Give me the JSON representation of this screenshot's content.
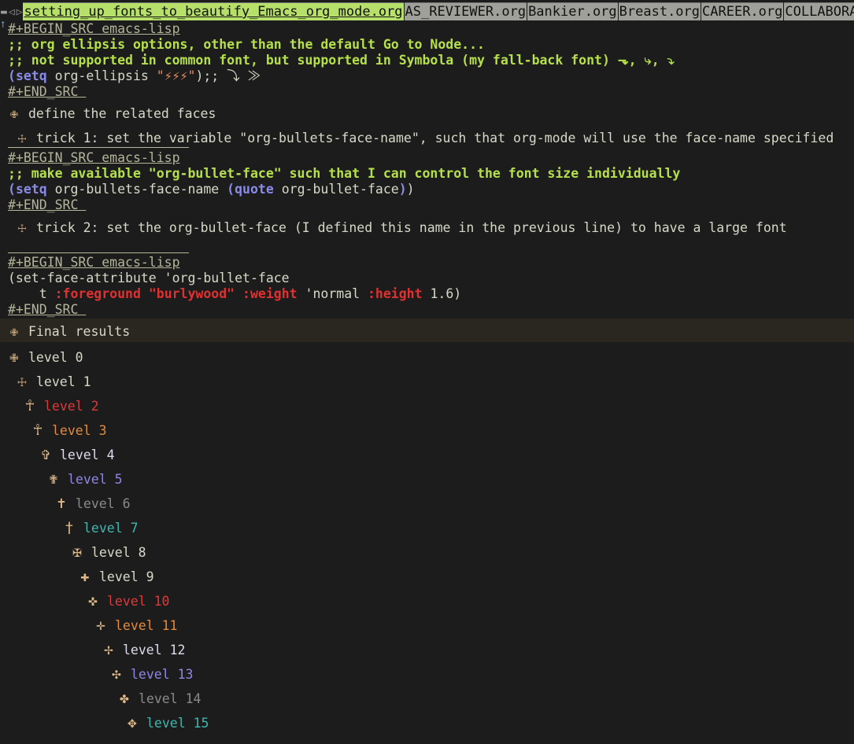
{
  "tabs": [
    {
      "label": "setting_up_fonts_to_beautify_Emacs_org_mode.org",
      "active": true
    },
    {
      "label": "AS_REVIEWER.org",
      "active": false
    },
    {
      "label": "Bankier.org",
      "active": false
    },
    {
      "label": "Breast.org",
      "active": false
    },
    {
      "label": "CAREER.org",
      "active": false
    },
    {
      "label": "COLLABORATI",
      "active": false
    }
  ],
  "tab_controls": {
    "collapse": "▬",
    "left": "◁",
    "right": "▷"
  },
  "scroll_up_indicator": "⭡",
  "block1": {
    "begin": "#+BEGIN_SRC emacs-lisp",
    "comment1": ";; org ellipsis options, other than the default Go to Node...",
    "comment2": ";; not supported in common font, but supported in Symbola (my fall-back font) ⬎, ⤷, ⤵",
    "code_open": "(",
    "code_setq": "setq",
    "code_var": " org-ellipsis ",
    "code_str": "\"⚡⚡⚡\"",
    "code_close": ");; ⤵ ≫",
    "end": "#+END_SRC "
  },
  "heading_define": {
    "bullet": "✙",
    "text": "define the related faces"
  },
  "trick1": {
    "bullet": "☩",
    "text": "trick 1: set the variable \"org-bullets-face-name\", such that org-mode will use the face-name specified"
  },
  "block2": {
    "begin": "#+BEGIN_SRC emacs-lisp",
    "comment": ";; make available \"org-bullet-face\" such that I can control the font size individually",
    "open": "(",
    "setq": "setq",
    "var": " org-bullets-face-name ",
    "qopen": "(",
    "quote": "quote",
    "qarg": " org-bullet-face",
    "qclose": ")",
    "close": ")",
    "end": "#+END_SRC "
  },
  "trick2": {
    "bullet": "☩",
    "text": "trick 2: set the org-bullet-face (I defined this name in the previous line) to have a large font"
  },
  "block3": {
    "begin": "#+BEGIN_SRC emacs-lisp",
    "line1": "(set-face-attribute 'org-bullet-face",
    "line2_indent": "    t ",
    "kw_foreground": ":foreground",
    "val_color": "\"burlywood\"",
    "kw_weight": ":weight",
    "val_weight": " 'normal ",
    "kw_height": ":height",
    "val_height": " 1.6)",
    "end": "#+END_SRC "
  },
  "final_heading": {
    "bullet": "✙",
    "text": "Final results"
  },
  "levels": [
    {
      "bullet": "✙",
      "text": "level 0",
      "color": "#d8d8c8"
    },
    {
      "bullet": "☩",
      "text": "level 1",
      "color": "#d8d8c8"
    },
    {
      "bullet": "☥",
      "text": "level 2",
      "color": "#e03838"
    },
    {
      "bullet": "☥",
      "text": "level 3",
      "color": "#e58a3a"
    },
    {
      "bullet": "✞",
      "text": "level 4",
      "color": "#dcdcec"
    },
    {
      "bullet": "✟",
      "text": "level 5",
      "color": "#8e86e8"
    },
    {
      "bullet": "✝",
      "text": "level 6",
      "color": "#8a8a8a"
    },
    {
      "bullet": "†",
      "text": "level 7",
      "color": "#3cb8b0"
    },
    {
      "bullet": "✠",
      "text": "level 8",
      "color": "#d8d8c8"
    },
    {
      "bullet": "✚",
      "text": "level 9",
      "color": "#d8d8c8"
    },
    {
      "bullet": "✜",
      "text": "level 10",
      "color": "#e03838"
    },
    {
      "bullet": "✛",
      "text": "level 11",
      "color": "#e58a3a"
    },
    {
      "bullet": "✢",
      "text": "level 12",
      "color": "#dcdcec"
    },
    {
      "bullet": "✣",
      "text": "level 13",
      "color": "#8e86e8"
    },
    {
      "bullet": "✤",
      "text": "level 14",
      "color": "#8a8a8a"
    },
    {
      "bullet": "✥",
      "text": "level 15",
      "color": "#3cb8b0"
    }
  ],
  "colors": {
    "background": "#1c1c1c",
    "bullet": "#deb887",
    "active_tab": "#b6e06a",
    "inactive_tab": "#a0a09a",
    "comment": "#b5e04a",
    "keyword": "#8a8ae8"
  }
}
